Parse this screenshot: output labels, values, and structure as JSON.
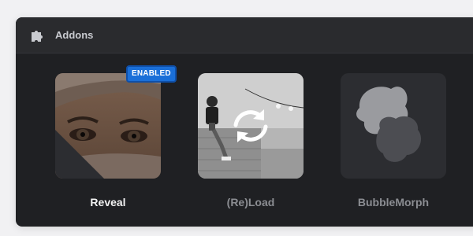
{
  "panel": {
    "title": "Addons",
    "icon": "puzzle-icon"
  },
  "addons": [
    {
      "label": "Reveal",
      "status": "ENABLED"
    },
    {
      "label": "(Re)Load",
      "icon": "reload-icon"
    },
    {
      "label": "BubbleMorph"
    }
  ],
  "colors": {
    "panel_bg": "#1f2023",
    "header_bg": "#2a2b2e",
    "badge_bg": "#1a6fd8",
    "label_active": "#f2f2f2",
    "label_inactive": "#8b8d92"
  }
}
